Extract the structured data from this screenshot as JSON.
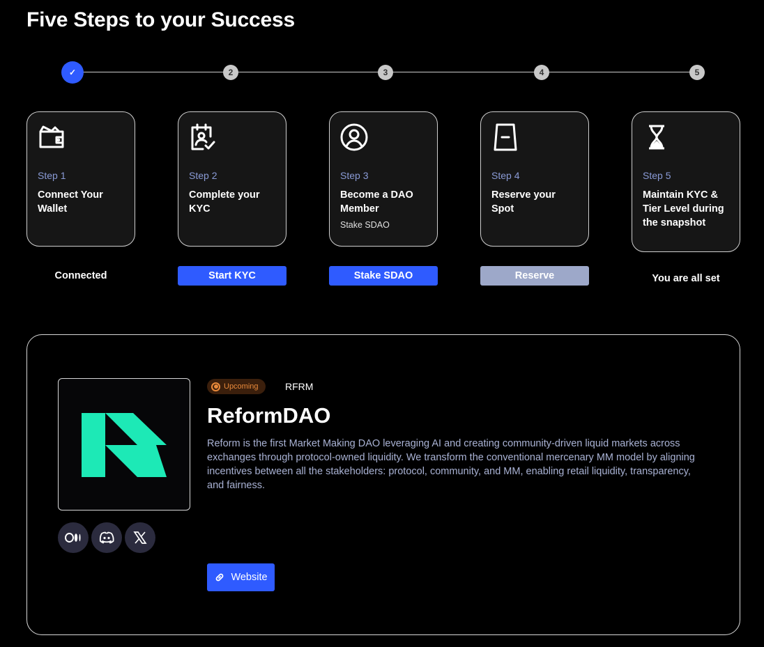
{
  "page_title": "Five Steps to your Success",
  "progress": {
    "completed_steps": 1,
    "markers": [
      "✓",
      "2",
      "3",
      "4",
      "5"
    ]
  },
  "steps": [
    {
      "step_label": "Step 1",
      "name": "Connect Your Wallet",
      "sub": "",
      "icon": "wallet-icon",
      "action": "Connected"
    },
    {
      "step_label": "Step 2",
      "name": "Complete your KYC",
      "sub": "",
      "icon": "kyc-clipboard-icon",
      "action": "Start KYC"
    },
    {
      "step_label": "Step 3",
      "name": "Become a DAO Member",
      "sub": "Stake SDAO",
      "icon": "member-icon",
      "action": "Stake SDAO"
    },
    {
      "step_label": "Step 4",
      "name": "Reserve your Spot",
      "sub": "",
      "icon": "ticket-icon",
      "action": "Reserve"
    },
    {
      "step_label": "Step 5",
      "name": "Maintain KYC & Tier Level during the snapshot",
      "sub": "",
      "icon": "hourglass-icon",
      "action": "You are all set"
    }
  ],
  "project": {
    "status": "Upcoming",
    "ticker": "RFRM",
    "name": "ReformDAO",
    "description": "Reform is the first Market Making DAO leveraging AI and creating community-driven liquid markets across exchanges through protocol-owned liquidity. We transform the conventional mercenary MM model by aligning incentives between all the stakeholders: protocol, community, and MM, enabling retail liquidity, transparency, and fairness.",
    "socials": [
      "medium-icon",
      "discord-icon",
      "x-icon"
    ],
    "website_label": "Website",
    "logo_color": "#1de9b6"
  },
  "colors": {
    "accent": "#2f5bff",
    "card_bg": "#161616",
    "step_label": "#8a9bd6",
    "disabled_button": "#9da8c9",
    "status_orange": "#e98a3b"
  }
}
